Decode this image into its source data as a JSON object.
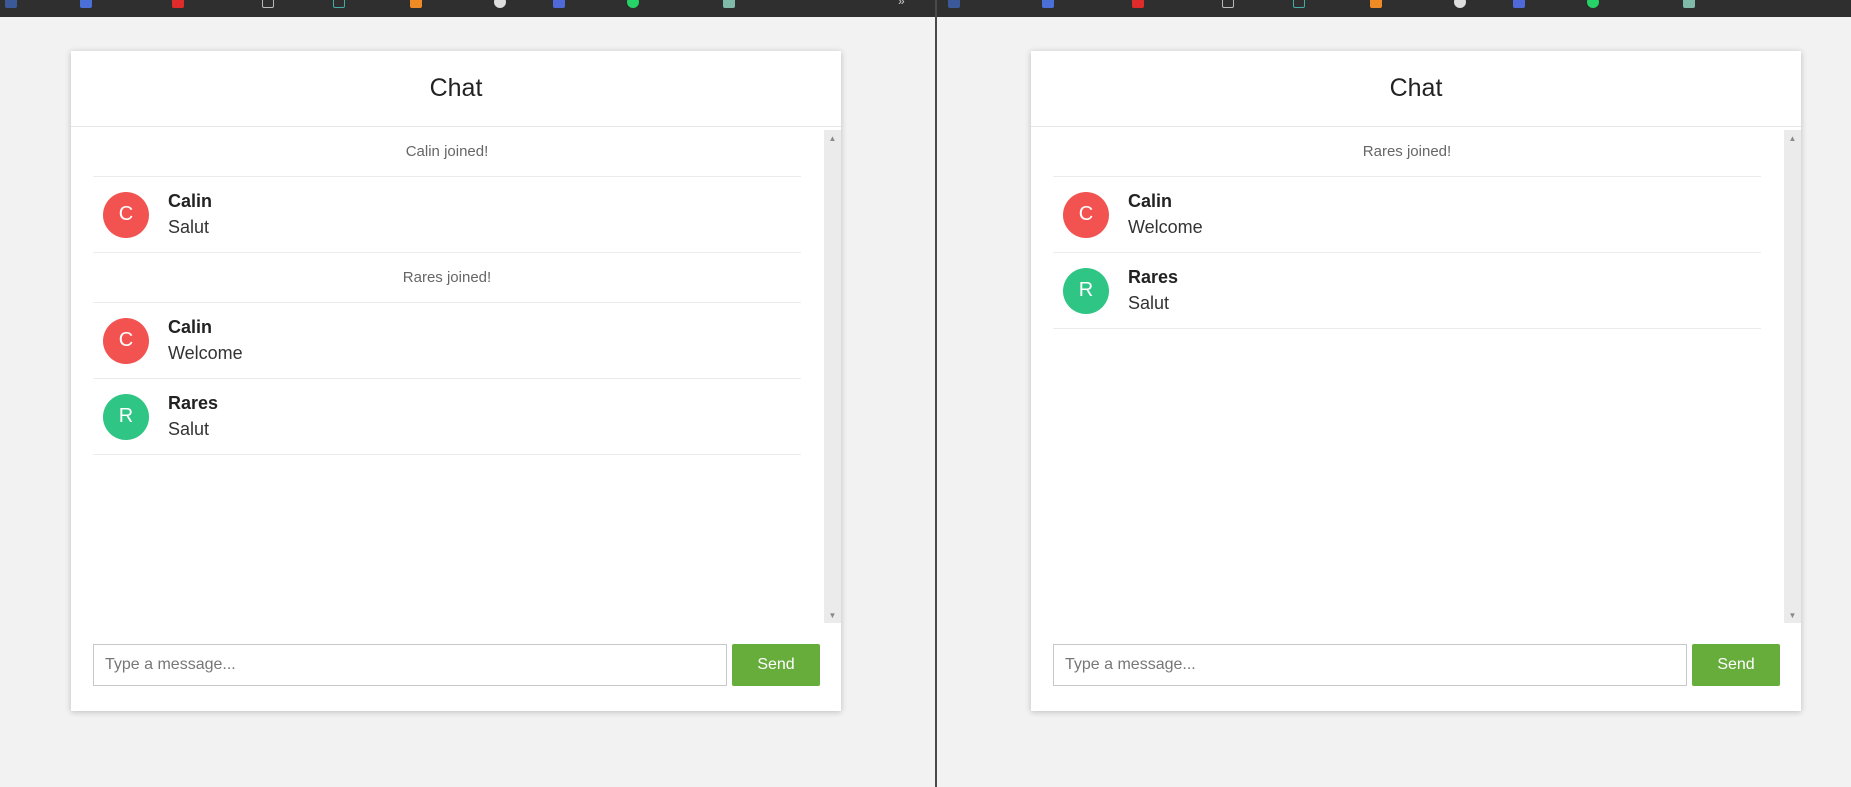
{
  "colors": {
    "avatar_calin": "#f35350",
    "avatar_rares": "#2fc584",
    "send_button": "#66ad3c"
  },
  "panes": [
    {
      "title": "Chat",
      "input_placeholder": "Type a message...",
      "send_label": "Send",
      "messages": [
        {
          "type": "system",
          "text": "Calin joined!"
        },
        {
          "type": "user",
          "initial": "C",
          "name": "Calin",
          "text": "Salut",
          "avatar_color": "#f35350"
        },
        {
          "type": "system",
          "text": "Rares joined!"
        },
        {
          "type": "user",
          "initial": "C",
          "name": "Calin",
          "text": "Welcome",
          "avatar_color": "#f35350"
        },
        {
          "type": "user",
          "initial": "R",
          "name": "Rares",
          "text": "Salut",
          "avatar_color": "#2fc584"
        }
      ]
    },
    {
      "title": "Chat",
      "input_placeholder": "Type a message...",
      "send_label": "Send",
      "messages": [
        {
          "type": "system",
          "text": "Rares joined!"
        },
        {
          "type": "user",
          "initial": "C",
          "name": "Calin",
          "text": "Welcome",
          "avatar_color": "#f35350"
        },
        {
          "type": "user",
          "initial": "R",
          "name": "Rares",
          "text": "Salut",
          "avatar_color": "#2fc584"
        }
      ]
    }
  ]
}
